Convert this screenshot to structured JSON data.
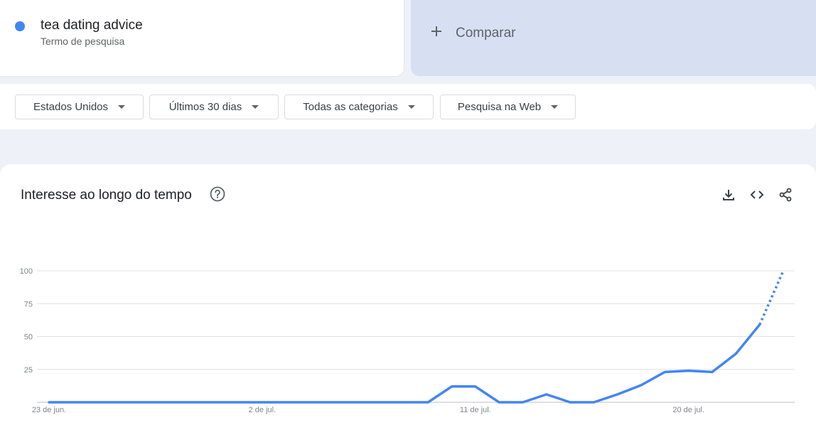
{
  "search_term": {
    "name": "tea dating advice",
    "subtitle": "Termo de pesquisa",
    "color": "#4285f4"
  },
  "compare": {
    "label": "Comparar",
    "icon": "plus-icon"
  },
  "filters": [
    {
      "label": "Estados Unidos",
      "icon": "caret-down-icon"
    },
    {
      "label": "Últimos 30 dias",
      "icon": "caret-down-icon"
    },
    {
      "label": "Todas as categorias",
      "icon": "caret-down-icon"
    },
    {
      "label": "Pesquisa na Web",
      "icon": "caret-down-icon"
    }
  ],
  "chart_panel": {
    "title": "Interesse ao longo do tempo",
    "help_icon": "help-circle-icon",
    "actions": [
      "download-icon",
      "embed-code-icon",
      "share-icon"
    ]
  },
  "chart_data": {
    "type": "line",
    "title": "Interesse ao longo do tempo",
    "xlabel": "",
    "ylabel": "",
    "ylim": [
      0,
      100
    ],
    "yticks": [
      25,
      50,
      75,
      100
    ],
    "grid": true,
    "x_tick_labels": [
      {
        "label": "23 de jun.",
        "day": 0
      },
      {
        "label": "2 de jul.",
        "day": 9
      },
      {
        "label": "11 de jul.",
        "day": 18
      },
      {
        "label": "20 de jul.",
        "day": 27
      }
    ],
    "series": [
      {
        "color": "#4285f4",
        "values": [
          0,
          0,
          0,
          0,
          0,
          0,
          0,
          0,
          0,
          0,
          0,
          0,
          0,
          0,
          0,
          0,
          0,
          12,
          12,
          0,
          0,
          6,
          0,
          0,
          6,
          13,
          23,
          24,
          23,
          37,
          59,
          100
        ],
        "partial_from": 30
      }
    ]
  }
}
